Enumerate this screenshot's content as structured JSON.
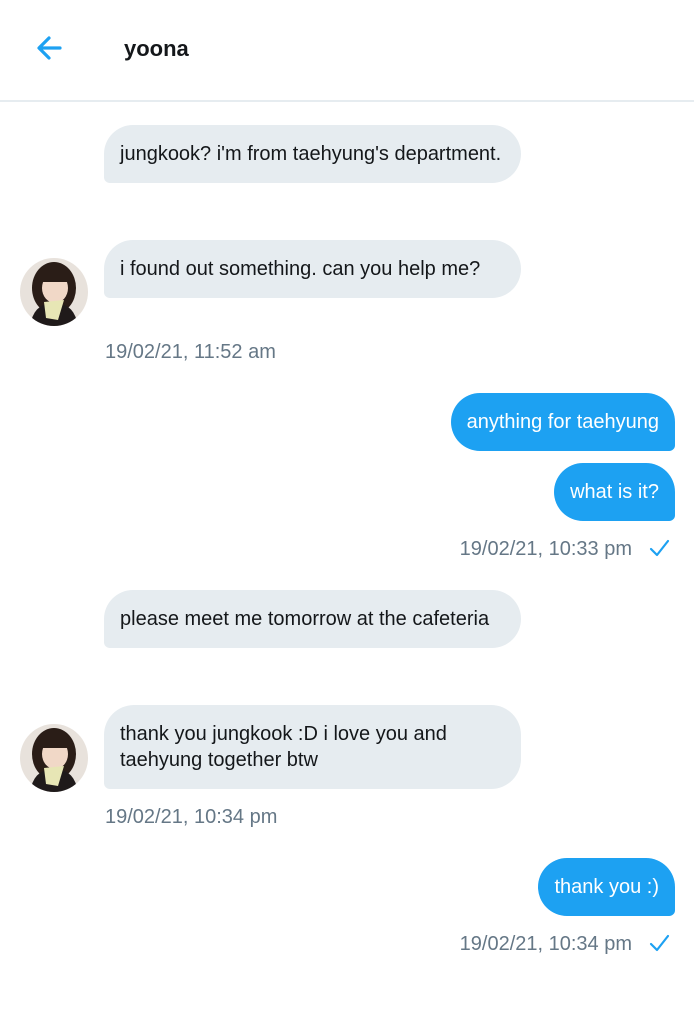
{
  "header": {
    "back_icon": "arrow-left-icon",
    "title": "yoona"
  },
  "colors": {
    "accent": "#1da1f2",
    "incoming_bubble": "#e6ecf0",
    "timestamp": "#657786"
  },
  "messages": [
    {
      "direction": "in",
      "text": "jungkook? i'm from taehyung's department."
    },
    {
      "direction": "in",
      "text": "i found out something. can you help me?"
    },
    {
      "direction": "out",
      "text": "anything for taehyung"
    },
    {
      "direction": "out",
      "text": "what is it?"
    },
    {
      "direction": "in",
      "text": "please meet me tomorrow at the cafeteria"
    },
    {
      "direction": "in",
      "text": "thank you jungkook :D i love you and taehyung together btw"
    },
    {
      "direction": "out",
      "text": "thank you :)"
    }
  ],
  "timestamps": [
    {
      "text": "19/02/21, 11:52 am",
      "side": "left"
    },
    {
      "text": "19/02/21, 10:33 pm",
      "side": "right",
      "read_icon": "checkmark-icon"
    },
    {
      "text": "19/02/21, 10:34 pm",
      "side": "left"
    },
    {
      "text": "19/02/21, 10:34 pm",
      "side": "right",
      "read_icon": "checkmark-icon"
    }
  ]
}
